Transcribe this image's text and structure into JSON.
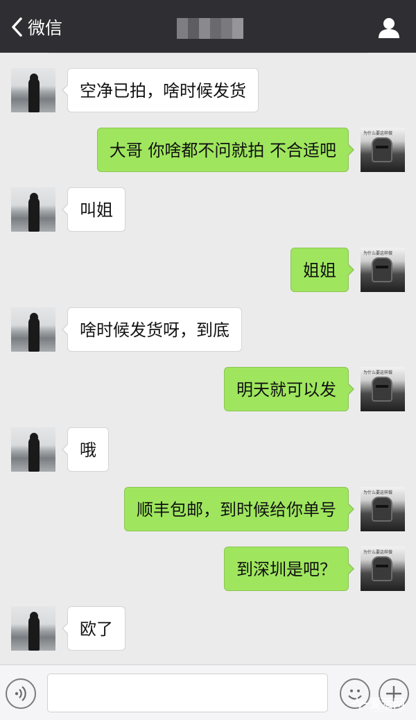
{
  "header": {
    "back_label": "微信",
    "title_blurred": true,
    "background": "#2f2f33"
  },
  "messages": [
    {
      "side": "in",
      "text": "空净已拍，啥时候发货"
    },
    {
      "side": "out",
      "text": "大哥 你啥都不问就拍 不合适吧"
    },
    {
      "side": "in",
      "text": "叫姐"
    },
    {
      "side": "out",
      "text": "姐姐"
    },
    {
      "side": "in",
      "text": "啥时候发货呀，到底"
    },
    {
      "side": "out",
      "text": "明天就可以发"
    },
    {
      "side": "in",
      "text": "哦"
    },
    {
      "side": "out",
      "text": "顺丰包邮，到时候给你单号"
    },
    {
      "side": "out",
      "text": "到深圳是吧？"
    },
    {
      "side": "in",
      "text": "欧了"
    }
  ],
  "my_avatar_caption": "为什么要这样做",
  "colors": {
    "chat_background": "#ebebeb",
    "outgoing_bubble": "#9fe65e",
    "incoming_bubble": "#ffffff"
  },
  "input_bar": {
    "text_value": "",
    "icons": [
      "voice-icon",
      "emoji-icon",
      "plus-icon"
    ]
  },
  "watermark": {
    "main": "爱活网",
    "sub": "EVOLIFE.CN"
  }
}
